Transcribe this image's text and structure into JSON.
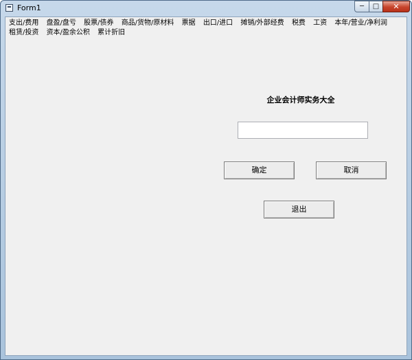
{
  "window": {
    "title": "Form1",
    "minimize_glyph": "─",
    "maximize_glyph": "□",
    "close_glyph": "✕"
  },
  "menu": {
    "row1": [
      "支出/费用",
      "盘盈/盘亏",
      "股票/债券",
      "商品/货物/原材料",
      "票据",
      "出口/进口",
      "摊销/外部经费",
      "税费",
      "工资",
      "本年/营业/净利润"
    ],
    "row2": [
      "租赁/投资",
      "资本/盈余公积",
      "累计折旧"
    ]
  },
  "main": {
    "heading": "企业会计师实务大全",
    "input_value": "",
    "ok_label": "确定",
    "cancel_label": "取消",
    "exit_label": "退出"
  }
}
